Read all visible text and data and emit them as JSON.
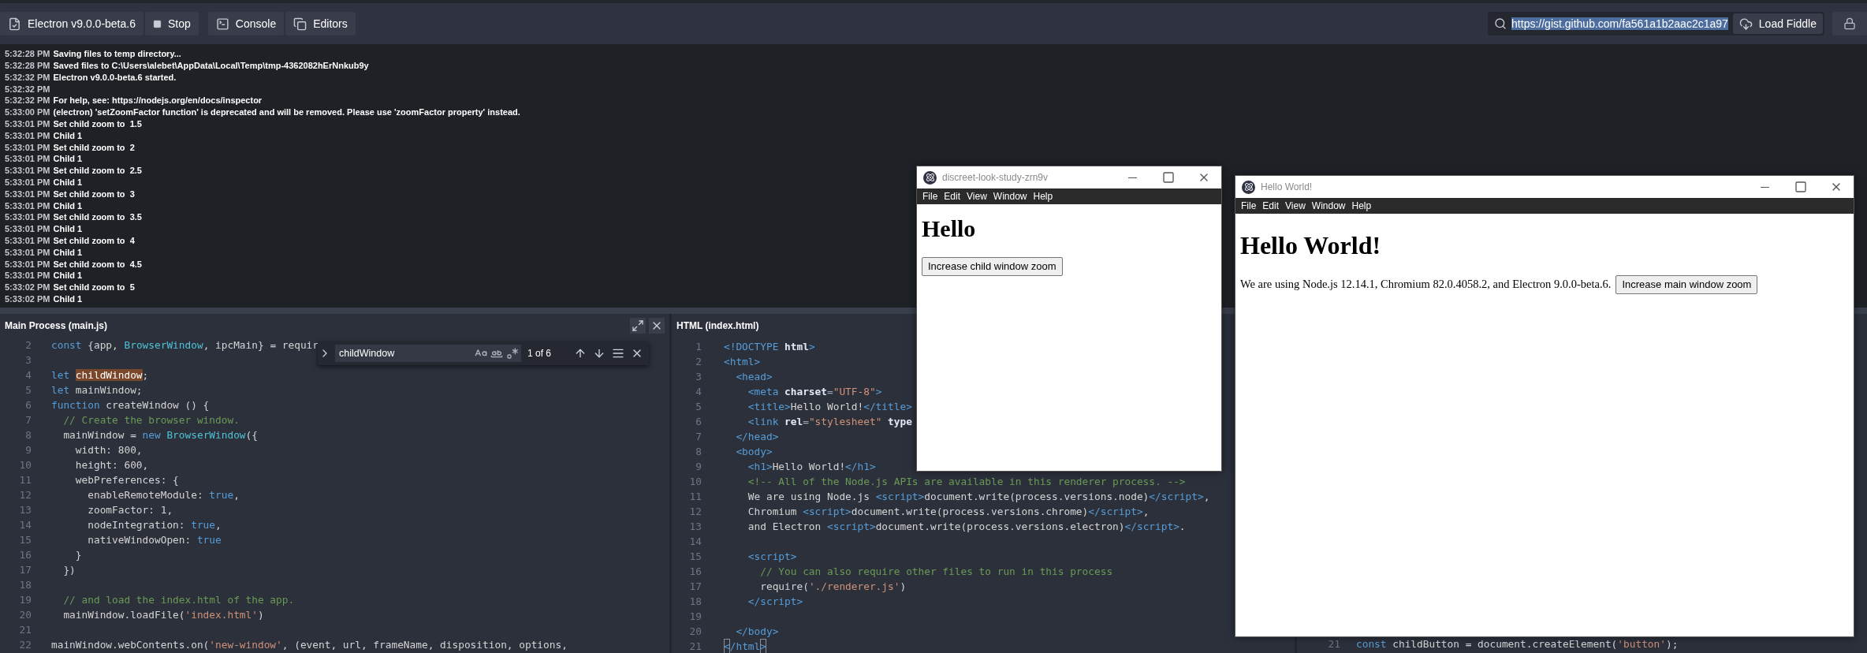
{
  "toolbar": {
    "left_buttons": [
      {
        "kind": "electron",
        "label": "Electron v9.0.0-beta.6"
      },
      {
        "kind": "stop",
        "label": "Stop"
      },
      {
        "kind": "console",
        "label": "Console"
      },
      {
        "kind": "editors",
        "label": "Editors"
      }
    ],
    "url_field": {
      "value": "https://gist.github.com/fa561a1b2aac2c1a97",
      "text_selected": true
    },
    "load_button": "Load Fiddle"
  },
  "console": {
    "lines": [
      {
        "time": "5:32:28 PM",
        "text": "Saving files to temp directory..."
      },
      {
        "time": "5:32:28 PM",
        "text": "Saved files to C:\\Users\\alebet\\AppData\\Local\\Temp\\tmp-4362082hErNnkub9y"
      },
      {
        "time": "5:32:32 PM",
        "text": "Electron v9.0.0-beta.6 started."
      },
      {
        "time": "5:32:32 PM"
      },
      {
        "time": "5:32:32 PM",
        "text": "For help, see: https://nodejs.org/en/docs/inspector"
      },
      {
        "time": "5:33:00 PM",
        "text": "(electron) 'setZoomFactor function' is deprecated and will be removed. Please use 'zoomFactor property' instead."
      },
      {
        "time": "5:33:01 PM",
        "text": "Set child zoom to  1.5"
      },
      {
        "time": "5:33:01 PM",
        "text": "Child 1"
      },
      {
        "time": "5:33:01 PM",
        "text": "Set child zoom to  2"
      },
      {
        "time": "5:33:01 PM",
        "text": "Child 1"
      },
      {
        "time": "5:33:01 PM",
        "text": "Set child zoom to  2.5"
      },
      {
        "time": "5:33:01 PM",
        "text": "Child 1"
      },
      {
        "time": "5:33:01 PM",
        "text": "Set child zoom to  3"
      },
      {
        "time": "5:33:01 PM",
        "text": "Child 1"
      },
      {
        "time": "5:33:01 PM",
        "text": "Set child zoom to  3.5"
      },
      {
        "time": "5:33:01 PM",
        "text": "Child 1"
      },
      {
        "time": "5:33:01 PM",
        "text": "Set child zoom to  4"
      },
      {
        "time": "5:33:01 PM",
        "text": "Child 1"
      },
      {
        "time": "5:33:01 PM",
        "text": "Set child zoom to  4.5"
      },
      {
        "time": "5:33:01 PM",
        "text": "Child 1"
      },
      {
        "time": "5:33:02 PM",
        "text": "Set child zoom to  5"
      },
      {
        "time": "5:33:02 PM",
        "text": "Child 1"
      }
    ]
  },
  "editors": [
    {
      "title": "Main Process (main.js)",
      "find": {
        "query": "childWindow",
        "match_count": "1 of 6"
      },
      "lines": [
        {
          "n": "2",
          "tokens": [
            {
              "kind": "kw",
              "text": "const"
            },
            {
              "kind": "pl",
              "text": " {app, "
            },
            {
              "kind": "fn",
              "text": "BrowserWindow"
            },
            {
              "kind": "pl",
              "text": ", ipcMain} = requir"
            }
          ]
        },
        {
          "n": "3"
        },
        {
          "n": "4",
          "tokens": [
            {
              "kind": "kw",
              "text": "let "
            },
            {
              "kind": "hl",
              "text": "childWindow"
            },
            {
              "kind": "pl",
              "text": ";"
            }
          ]
        },
        {
          "n": "5",
          "tokens": [
            {
              "kind": "kw",
              "text": "let"
            },
            {
              "kind": "pl",
              "text": " mainWindow;"
            }
          ]
        },
        {
          "n": "6",
          "tokens": [
            {
              "kind": "kw",
              "text": "function"
            },
            {
              "kind": "pl",
              "text": " createWindow () {"
            }
          ]
        },
        {
          "n": "7",
          "tokens": [
            {
              "kind": "cm",
              "text": "  // Create the browser window."
            }
          ]
        },
        {
          "n": "8",
          "tokens": [
            {
              "kind": "pl",
              "text": "  mainWindow = "
            },
            {
              "kind": "kw",
              "text": "new "
            },
            {
              "kind": "fn",
              "text": "BrowserWindow"
            },
            {
              "kind": "pl",
              "text": "({"
            }
          ]
        },
        {
          "n": "9",
          "tokens": [
            {
              "kind": "pl",
              "text": "    width: 800,"
            }
          ]
        },
        {
          "n": "10",
          "tokens": [
            {
              "kind": "pl",
              "text": "    height: 600,"
            }
          ]
        },
        {
          "n": "11",
          "tokens": [
            {
              "kind": "pl",
              "text": "    webPreferences: {"
            }
          ]
        },
        {
          "n": "12",
          "tokens": [
            {
              "kind": "pl",
              "text": "      enableRemoteModule: "
            },
            {
              "kind": "kw",
              "text": "true"
            },
            {
              "kind": "pl",
              "text": ","
            }
          ]
        },
        {
          "n": "13",
          "tokens": [
            {
              "kind": "pl",
              "text": "      zoomFactor: 1,"
            }
          ]
        },
        {
          "n": "14",
          "tokens": [
            {
              "kind": "pl",
              "text": "      nodeIntegration: "
            },
            {
              "kind": "kw",
              "text": "true"
            },
            {
              "kind": "pl",
              "text": ","
            }
          ]
        },
        {
          "n": "15",
          "tokens": [
            {
              "kind": "pl",
              "text": "      nativeWindowOpen: "
            },
            {
              "kind": "kw",
              "text": "true"
            }
          ]
        },
        {
          "n": "16",
          "tokens": [
            {
              "kind": "pl",
              "text": "    }"
            }
          ]
        },
        {
          "n": "17",
          "tokens": [
            {
              "kind": "pl",
              "text": "  })"
            }
          ]
        },
        {
          "n": "18"
        },
        {
          "n": "19",
          "tokens": [
            {
              "kind": "cm",
              "text": "  // and load the index.html of the app."
            }
          ]
        },
        {
          "n": "20",
          "tokens": [
            {
              "kind": "pl",
              "text": "  mainWindow.loadFile("
            },
            {
              "kind": "str",
              "text": "'index.html'"
            },
            {
              "kind": "pl",
              "text": ")"
            }
          ]
        },
        {
          "n": "21"
        },
        {
          "n": "22",
          "tokens": [
            {
              "kind": "pl",
              "text": "mainWindow.webContents.on("
            },
            {
              "kind": "str",
              "text": "'new-window'"
            },
            {
              "kind": "pl",
              "text": ", (event, url, frameName, disposition, options,"
            }
          ]
        }
      ]
    },
    {
      "title": "HTML (index.html)",
      "lines": [
        {
          "n": "1",
          "tokens": [
            {
              "kind": "tag",
              "text": "<!DOCTYPE"
            },
            {
              "kind": "attr",
              "text": " html"
            },
            {
              "kind": "tag",
              "text": ">"
            }
          ]
        },
        {
          "n": "2",
          "tokens": [
            {
              "kind": "tag",
              "text": "<html>"
            }
          ]
        },
        {
          "n": "3",
          "tokens": [
            {
              "kind": "tag",
              "text": "  <head>"
            }
          ]
        },
        {
          "n": "4",
          "tokens": [
            {
              "kind": "tag",
              "text": "    <meta"
            },
            {
              "kind": "attr",
              "text": " charset"
            },
            {
              "kind": "pu",
              "text": "="
            },
            {
              "kind": "str",
              "text": "\"UTF-8\""
            },
            {
              "kind": "tag",
              "text": ">"
            }
          ]
        },
        {
          "n": "5",
          "tokens": [
            {
              "kind": "tag",
              "text": "    <title>"
            },
            {
              "kind": "pl",
              "text": "Hello World!"
            },
            {
              "kind": "tag",
              "text": "</title>"
            }
          ]
        },
        {
          "n": "6",
          "tokens": [
            {
              "kind": "tag",
              "text": "    <link"
            },
            {
              "kind": "attr",
              "text": " rel"
            },
            {
              "kind": "pu",
              "text": "="
            },
            {
              "kind": "str",
              "text": "\"stylesheet\""
            },
            {
              "kind": "attr",
              "text": " type"
            }
          ]
        },
        {
          "n": "7",
          "tokens": [
            {
              "kind": "tag",
              "text": "  </head>"
            }
          ]
        },
        {
          "n": "8",
          "tokens": [
            {
              "kind": "tag",
              "text": "  <body>"
            }
          ]
        },
        {
          "n": "9",
          "tokens": [
            {
              "kind": "tag",
              "text": "    <h1>"
            },
            {
              "kind": "pl",
              "text": "Hello World!"
            },
            {
              "kind": "tag",
              "text": "</h1>"
            }
          ]
        },
        {
          "n": "10",
          "tokens": [
            {
              "kind": "cm",
              "text": "    <!-- All of the Node.js APIs are available in this renderer process. -->"
            }
          ]
        },
        {
          "n": "11",
          "tokens": [
            {
              "kind": "pl",
              "text": "    We are using Node.js "
            },
            {
              "kind": "tag",
              "text": "<script>"
            },
            {
              "kind": "pl",
              "text": "document.write(process.versions.node)"
            },
            {
              "kind": "tag",
              "text": "</script>"
            },
            {
              "kind": "pl",
              "text": ","
            }
          ]
        },
        {
          "n": "12",
          "tokens": [
            {
              "kind": "pl",
              "text": "    Chromium "
            },
            {
              "kind": "tag",
              "text": "<script>"
            },
            {
              "kind": "pl",
              "text": "document.write(process.versions.chrome)"
            },
            {
              "kind": "tag",
              "text": "</script>"
            },
            {
              "kind": "pl",
              "text": ","
            }
          ]
        },
        {
          "n": "13",
          "tokens": [
            {
              "kind": "pl",
              "text": "    and Electron "
            },
            {
              "kind": "tag",
              "text": "<script>"
            },
            {
              "kind": "pl",
              "text": "document.write(process.versions.electron)"
            },
            {
              "kind": "tag",
              "text": "</script>"
            },
            {
              "kind": "pl",
              "text": "."
            }
          ]
        },
        {
          "n": "14"
        },
        {
          "n": "15",
          "tokens": [
            {
              "kind": "tag",
              "text": "    <script>"
            }
          ]
        },
        {
          "n": "16",
          "tokens": [
            {
              "kind": "cm",
              "text": "      // You can also require other files to run in this process"
            }
          ]
        },
        {
          "n": "17",
          "tokens": [
            {
              "kind": "pl",
              "text": "      require("
            },
            {
              "kind": "str",
              "text": "'./renderer.js'"
            },
            {
              "kind": "pl",
              "text": ")"
            }
          ]
        },
        {
          "n": "18",
          "tokens": [
            {
              "kind": "tag",
              "text": "    </script>"
            }
          ]
        },
        {
          "n": "19"
        },
        {
          "n": "20",
          "tokens": [
            {
              "kind": "tag",
              "text": "  </body>"
            }
          ]
        },
        {
          "n": "21",
          "tokens": [
            {
              "kind": "match",
              "text": "<"
            },
            {
              "kind": "tag",
              "text": "/html"
            },
            {
              "kind": "match",
              "text": ">"
            }
          ]
        }
      ]
    },
    {
      "lines": [
        {
          "n": "21",
          "tokens": [
            {
              "kind": "kw",
              "text": "const"
            },
            {
              "kind": "pl",
              "text": " childButton = document.createElement("
            },
            {
              "kind": "str",
              "text": "'button'"
            },
            {
              "kind": "pl",
              "text": ");"
            }
          ]
        }
      ]
    }
  ],
  "windows": [
    {
      "kind": "child",
      "title": "discreet-look-study-zrn9v",
      "menu": [
        "File",
        "Edit",
        "View",
        "Window",
        "Help"
      ],
      "heading": "Hello",
      "button": "Increase child window zoom"
    },
    {
      "kind": "main",
      "title": "Hello World!",
      "menu": [
        "File",
        "Edit",
        "View",
        "Window",
        "Help"
      ],
      "heading": "Hello World!",
      "text": "We are using Node.js 12.14.1, Chromium 82.0.4058.2, and Electron 9.0.0-beta.6.",
      "button": "Increase main window zoom"
    }
  ]
}
